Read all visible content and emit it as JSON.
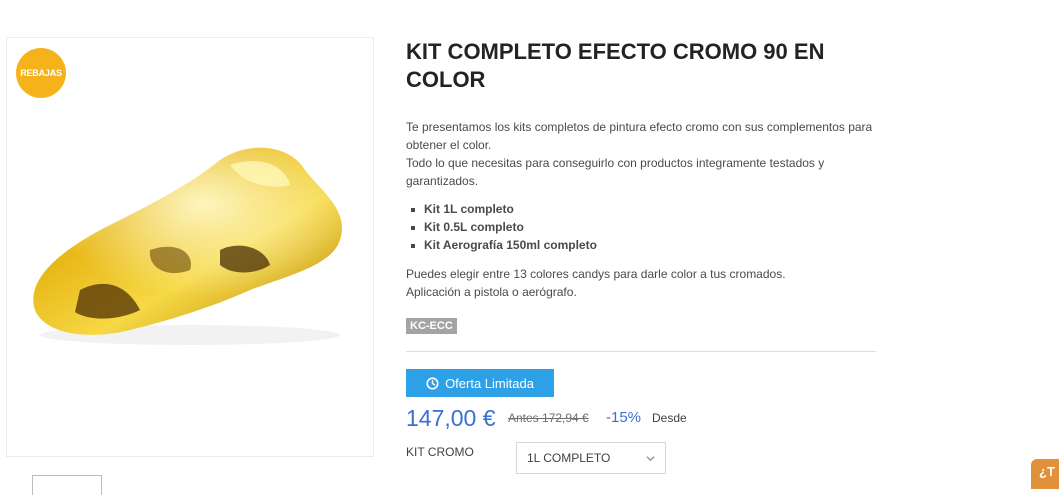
{
  "product": {
    "badge": "REBAJAS",
    "title": "KIT COMPLETO EFECTO CROMO 90 EN COLOR",
    "description": [
      "Te presentamos los kits completos de pintura efecto cromo con sus complementos para obtener el color.",
      "Todo lo que necesitas para conseguirlo con productos integramente testados y garantizados."
    ],
    "features": [
      "Kit 1L completo",
      "Kit 0.5L completo",
      "Kit Aerografía 150ml completo"
    ],
    "extra": [
      "Puedes elegir entre 13 colores candys para darle color a tus cromados.",
      "Aplicación a pistola o aerógrafo."
    ],
    "reference": "KC-ECC"
  },
  "offer": {
    "label": "Oferta Limitada",
    "icon": "clock-icon"
  },
  "pricing": {
    "price": "147,00 €",
    "old_price": "Antes 172,94 €",
    "discount": "-15%",
    "from_label": "Desde"
  },
  "variant": {
    "label": "KIT CROMO",
    "selected": "1L COMPLETO"
  },
  "help_tab": {
    "text": "¿T"
  },
  "colors": {
    "accent": "#2da0e6",
    "price": "#3b6fd6",
    "badge": "#f6b21b",
    "help": "#e0913a"
  }
}
